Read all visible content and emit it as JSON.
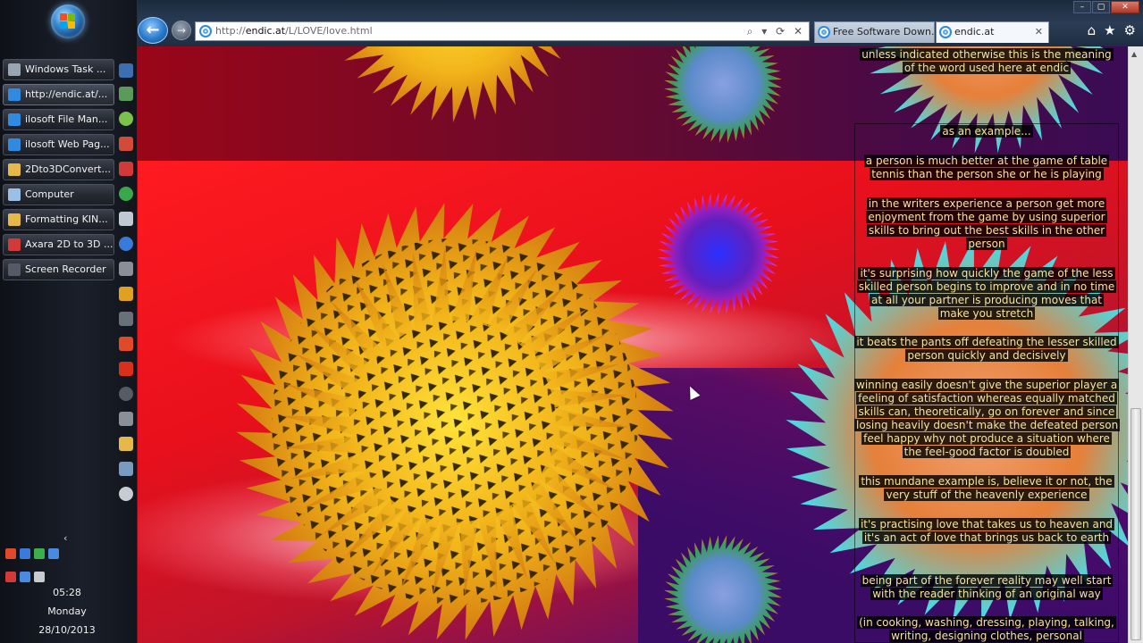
{
  "taskbar": {
    "items": [
      {
        "label": "Windows Task ...",
        "icon": "task-manager-icon",
        "color": "#9aa4b2"
      },
      {
        "label": "http://endic.at/...",
        "icon": "ie-icon",
        "color": "#2f8ae0",
        "active": true
      },
      {
        "label": "ilosoft File Man...",
        "icon": "ie-icon",
        "color": "#2f8ae0"
      },
      {
        "label": "ilosoft Web Pag...",
        "icon": "ie-icon",
        "color": "#2f8ae0"
      },
      {
        "label": "2Dto3DConvert...",
        "icon": "folder-icon",
        "color": "#e6b84a"
      },
      {
        "label": "Computer",
        "icon": "computer-icon",
        "color": "#9ac0e6"
      },
      {
        "label": "Formatting KIN...",
        "icon": "folder-icon",
        "color": "#e6b84a"
      },
      {
        "label": "Axara 2D to 3D ...",
        "icon": "axara-icon",
        "color": "#d23a3a"
      },
      {
        "label": "Screen Recorder",
        "icon": "recorder-icon",
        "color": "#555b66"
      }
    ],
    "clock": {
      "time": "05:28",
      "day": "Monday",
      "date": "28/10/2013"
    }
  },
  "browser": {
    "address": {
      "prefix": "http://",
      "host": "endic.at",
      "path": "/L/LOVE/love.html"
    },
    "tabs": [
      {
        "label": "Free Software Down...",
        "active": false
      },
      {
        "label": "endic.at",
        "active": true
      }
    ],
    "window_controls": {
      "minimize": "–",
      "maximize": "▢",
      "close": "✕"
    },
    "tab_close": "✕",
    "nav": {
      "back": "←",
      "forward": "→"
    },
    "addr_tools": "⌕ ▾ ⟳ ✕",
    "right_icons": {
      "home": "⌂",
      "favorites": "★",
      "tools": "⚙"
    }
  },
  "page": {
    "paragraphs": [
      "unless indicated otherwise this is the meaning of the word used here at endic",
      "as an example...",
      "a person is much better at the game of table tennis than the person she or he is playing",
      "in the writers experience a person get more enjoyment from the game by using superior skills to bring out the best skills in the other person",
      "it's surprising how quickly the game of the less skilled person begins to improve and in no time at all your partner is producing moves that make you stretch",
      "it beats the pants off defeating the lesser skilled person quickly and decisively",
      "winning easily doesn't give the superior player a feeling of satisfaction whereas equally matched skills can, theoretically, go on forever and since losing heavily doesn't make the defeated person feel happy why not produce a situation where the feel-good factor is doubled",
      "this mundane example is, believe it or not, the very stuff of the heavenly experience",
      "it's practising love that takes us to heaven and it's an act of love that brings us back to earth",
      "being part of the forever reality may well start with the reader thinking of an original way",
      "(in cooking, washing, dressing, playing, talking, writing, designing clothes, personal"
    ]
  },
  "colors": {
    "accent": "#2f8ae0",
    "text_highlight": "#f6e3a0"
  }
}
